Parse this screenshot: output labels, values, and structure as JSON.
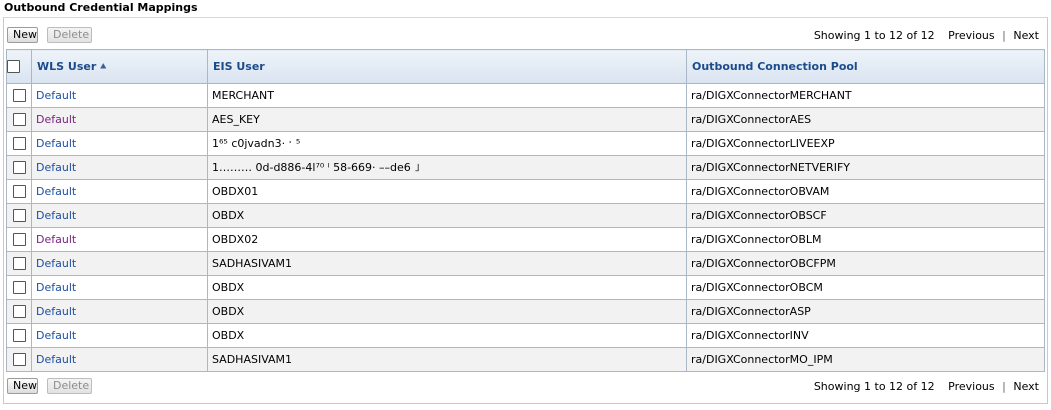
{
  "section_title": "Outbound Credential Mappings",
  "buttons": {
    "new": "New",
    "delete": "Delete"
  },
  "paging": {
    "showing": "Showing 1 to 12 of 12",
    "previous": "Previous",
    "separator": "|",
    "next": "Next"
  },
  "table": {
    "columns": [
      "WLS User",
      "EIS User",
      "Outbound Connection Pool"
    ],
    "sort_icon": "sort-ascending-icon",
    "rows": [
      {
        "wls_user": "Default",
        "visited": false,
        "eis_user": "MERCHANT",
        "pool": "ra/DIGXConnectorMERCHANT"
      },
      {
        "wls_user": "Default",
        "visited": true,
        "eis_user": "AES_KEY",
        "pool": "ra/DIGXConnectorAES"
      },
      {
        "wls_user": "Default",
        "visited": false,
        "eis_user": "1⁶⁵     c0jvadn3·  ˑ ⁵",
        "pool": "ra/DIGXConnectorLIVEEXP"
      },
      {
        "wls_user": "Default",
        "visited": false,
        "eis_user": "1……… 0d-d886-4l⁷⁰ ˡ   58-669· ––de6   ˩",
        "pool": "ra/DIGXConnectorNETVERIFY"
      },
      {
        "wls_user": "Default",
        "visited": false,
        "eis_user": "OBDX01",
        "pool": "ra/DIGXConnectorOBVAM"
      },
      {
        "wls_user": "Default",
        "visited": false,
        "eis_user": "OBDX",
        "pool": "ra/DIGXConnectorOBSCF"
      },
      {
        "wls_user": "Default",
        "visited": true,
        "eis_user": "OBDX02",
        "pool": "ra/DIGXConnectorOBLM"
      },
      {
        "wls_user": "Default",
        "visited": false,
        "eis_user": "SADHASIVAM1",
        "pool": "ra/DIGXConnectorOBCFPM"
      },
      {
        "wls_user": "Default",
        "visited": false,
        "eis_user": "OBDX",
        "pool": "ra/DIGXConnectorOBCM"
      },
      {
        "wls_user": "Default",
        "visited": false,
        "eis_user": "OBDX",
        "pool": "ra/DIGXConnectorASP"
      },
      {
        "wls_user": "Default",
        "visited": false,
        "eis_user": "OBDX",
        "pool": "ra/DIGXConnectorINV"
      },
      {
        "wls_user": "Default",
        "visited": false,
        "eis_user": "SADHASIVAM1",
        "pool": "ra/DIGXConnectorMO_IPM"
      }
    ]
  },
  "colors": {
    "header_text": "#1c4b8c",
    "link": "#1d4fa1",
    "visited_link": "#7a2380",
    "grid_border": "#a9b7c6"
  }
}
